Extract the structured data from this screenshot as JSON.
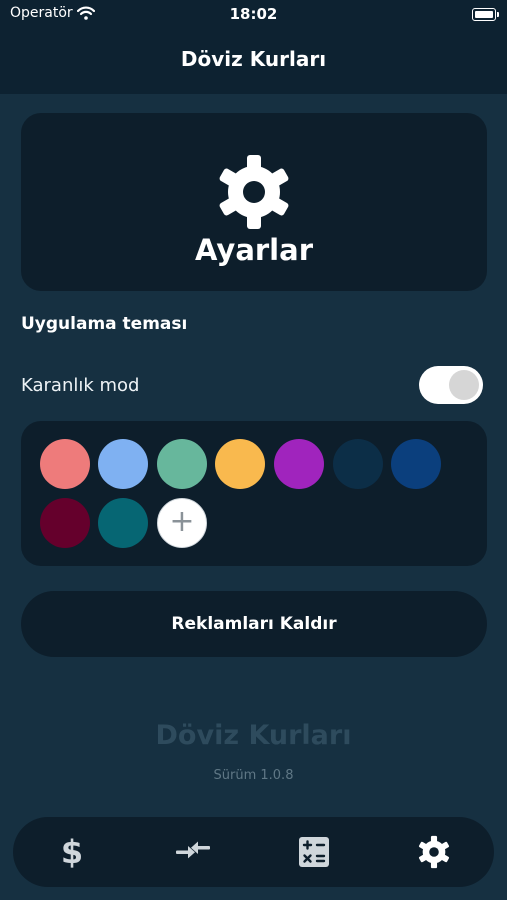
{
  "status_bar": {
    "carrier": "Operatör",
    "time": "18:02"
  },
  "nav": {
    "title": "Döviz Kurları"
  },
  "header_card": {
    "icon": "gear-icon",
    "title": "Ayarlar"
  },
  "theme": {
    "section_label": "Uygulama teması",
    "dark_mode_label": "Karanlık mod",
    "dark_mode_on": true,
    "colors": [
      "#ee7b7b",
      "#7fb1f2",
      "#67b79c",
      "#f9b94e",
      "#a024bd",
      "#0c2e47",
      "#0b3f7d",
      "#65002c",
      "#066673"
    ],
    "add_color_symbol": "+"
  },
  "remove_ads_label": "Reklamları Kaldır",
  "footer": {
    "app_name": "Döviz Kurları",
    "version": "Sürüm 1.0.8"
  },
  "tabs": [
    {
      "icon": "dollar-icon",
      "symbol": "$"
    },
    {
      "icon": "exchange-arrows-icon"
    },
    {
      "icon": "calculator-icon"
    },
    {
      "icon": "gear-icon",
      "active": true
    }
  ]
}
